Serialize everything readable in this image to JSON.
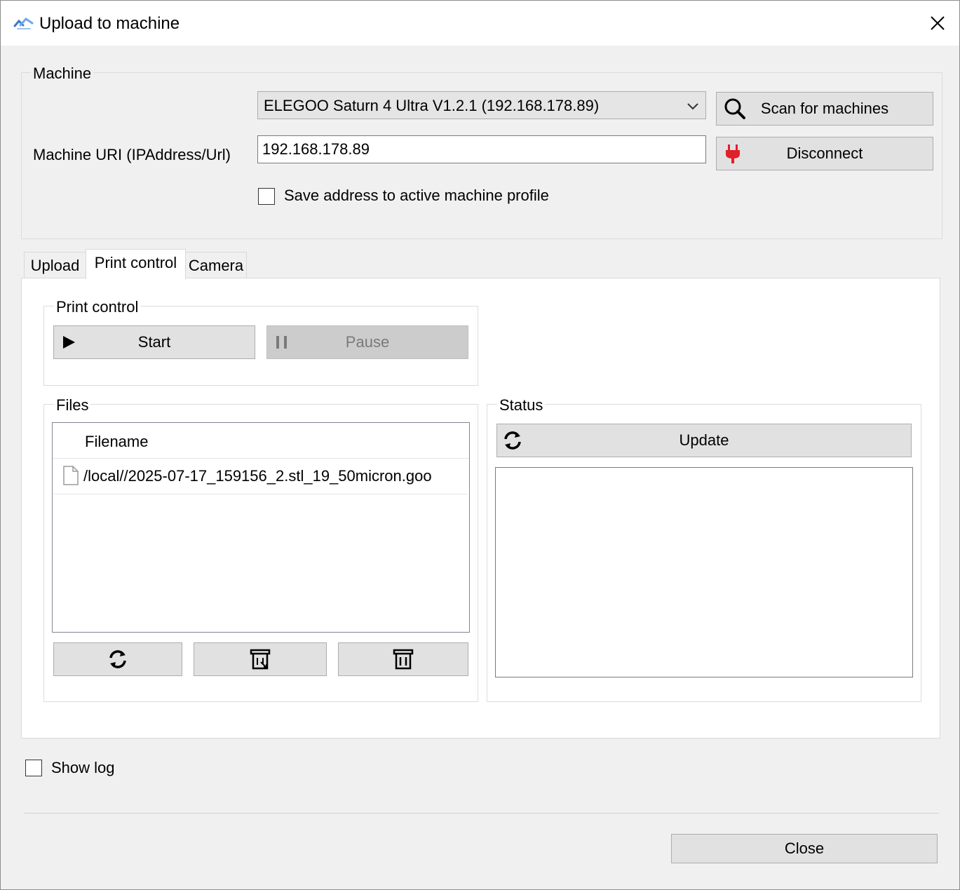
{
  "window": {
    "title": "Upload to machine"
  },
  "machine_group": {
    "label": "Machine",
    "selected_machine": "ELEGOO Saturn 4 Ultra V1.2.1 (192.168.178.89)",
    "scan_button": "Scan for machines",
    "uri_label": "Machine URI (IPAddress/Url)",
    "uri_value": "192.168.178.89",
    "disconnect_button": "Disconnect",
    "save_address_label": "Save address to active machine profile",
    "save_address_checked": false
  },
  "tabs": [
    {
      "label": "Upload",
      "active": false
    },
    {
      "label": "Print control",
      "active": true
    },
    {
      "label": "Camera",
      "active": false
    }
  ],
  "print_control_group": {
    "label": "Print control",
    "start_button": "Start",
    "pause_button": "Pause",
    "pause_disabled": true
  },
  "files_group": {
    "label": "Files",
    "column_header": "Filename",
    "files": [
      "/local//2025-07-17_159156_2.stl_19_50micron.goo"
    ],
    "action_icons": [
      "refresh-icon",
      "download-archive-icon",
      "trash-icon"
    ]
  },
  "status_group": {
    "label": "Status",
    "update_button": "Update",
    "status_text": ""
  },
  "footer": {
    "show_log_label": "Show log",
    "show_log_checked": false,
    "close_button": "Close"
  },
  "colors": {
    "window_bg": "#f0f0f0",
    "button_bg": "#e1e1e1",
    "button_border": "#adadad",
    "disabled_bg": "#cccccc",
    "disconnect_icon": "#e0202a",
    "title_icon": "#3a78c8"
  }
}
